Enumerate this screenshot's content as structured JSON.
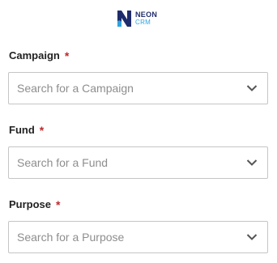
{
  "brand": {
    "name": "NEON",
    "sub": "CRM"
  },
  "fields": [
    {
      "label": "Campaign",
      "required_mark": "*",
      "placeholder": "Search for a Campaign"
    },
    {
      "label": "Fund",
      "required_mark": "*",
      "placeholder": "Search for a Fund"
    },
    {
      "label": "Purpose",
      "required_mark": "*",
      "placeholder": "Search for a Purpose"
    }
  ],
  "icons": {
    "dropdown": "chevron-down-icon",
    "logo": "neon-crm-logo"
  },
  "colors": {
    "required": "#c0282c",
    "brand_dark": "#1f2c6b",
    "brand_light": "#2fa3e0"
  }
}
